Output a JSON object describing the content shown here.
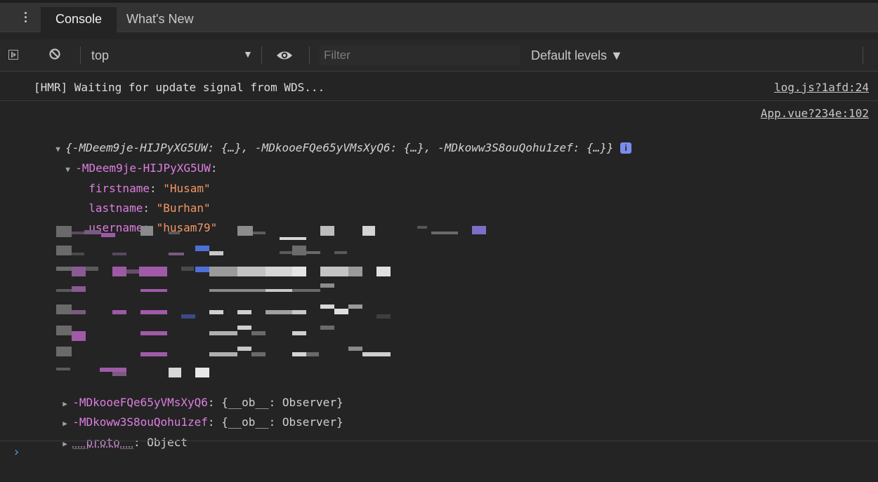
{
  "tabs": [
    {
      "label": "Console",
      "active": true
    },
    {
      "label": "What's New",
      "active": false
    }
  ],
  "toolbar": {
    "context": "top",
    "filter_placeholder": "Filter",
    "levels": "Default levels ▼"
  },
  "messages": {
    "hmr": {
      "text": "[HMR] Waiting for update signal from WDS...",
      "source": "log.js?1afd:24"
    },
    "object_log": {
      "source": "App.vue?234e:102",
      "preview": "{-MDeem9je-HIJPyXG5UW: {…}, -MDkooeFQe65yVMsXyQ6: {…}, -MDkoww3S8ouQohu1zef: {…}}",
      "info_badge": "i",
      "expanded_key": "-MDeem9je-HIJPyXG5UW",
      "fields": [
        {
          "key": "firstname",
          "value": "\"Husam\""
        },
        {
          "key": "lastname",
          "value": "\"Burhan\""
        },
        {
          "key": "username",
          "value": "\"husam79\""
        }
      ],
      "collapsed": [
        {
          "key": "-MDkooeFQe65yVMsXyQ6",
          "value": ": {__ob__: Observer}"
        },
        {
          "key": "-MDkoww3S8ouQohu1zef",
          "value": ": {__ob__: Observer}"
        }
      ],
      "proto": {
        "key": "__proto__",
        "value": ": Object"
      }
    }
  },
  "colors": {
    "background": "#242424",
    "key": "#de7ee0",
    "string": "#f29766",
    "prompt": "#4d9cf0"
  }
}
